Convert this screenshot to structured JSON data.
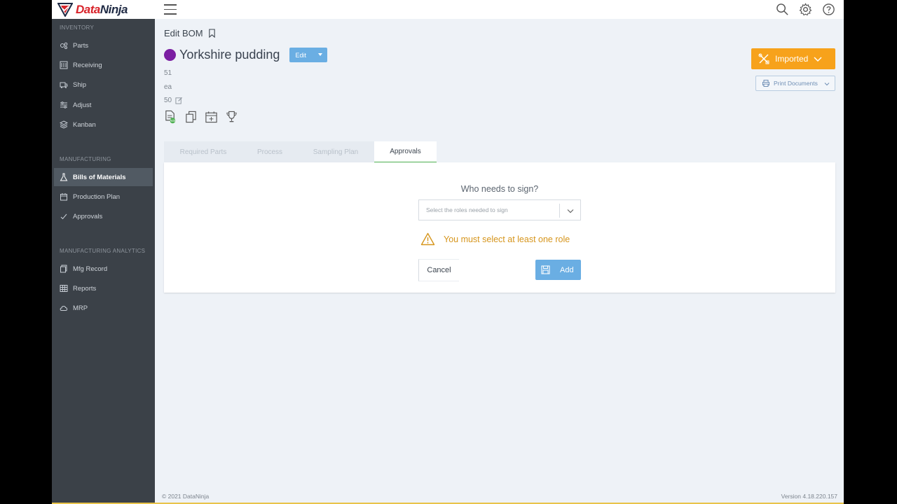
{
  "app": {
    "logo_text_accent": "Data",
    "logo_text_main": "Ninja"
  },
  "sidebar": {
    "sections": [
      {
        "label": "INVENTORY"
      },
      {
        "label": "MANUFACTURING"
      },
      {
        "label": "MANUFACTURING ANALYTICS"
      }
    ],
    "items": [
      {
        "label": "Parts",
        "icon": "parts-icon"
      },
      {
        "label": "Receiving",
        "icon": "receiving-icon"
      },
      {
        "label": "Ship",
        "icon": "ship-icon"
      },
      {
        "label": "Adjust",
        "icon": "adjust-icon"
      },
      {
        "label": "Kanban",
        "icon": "kanban-icon"
      },
      {
        "label": "Bills of Materials",
        "icon": "flask-icon"
      },
      {
        "label": "Production Plan",
        "icon": "calendar-icon"
      },
      {
        "label": "Approvals",
        "icon": "check-icon"
      },
      {
        "label": "Mfg Record",
        "icon": "record-icon"
      },
      {
        "label": "Reports",
        "icon": "reports-icon"
      },
      {
        "label": "MRP",
        "icon": "cloud-icon"
      }
    ],
    "active_item": "Bills of Materials"
  },
  "page": {
    "header": "Edit BOM",
    "bom_name": "Yorkshire pudding",
    "bom_color": "#7b1fa2",
    "edit_label": "Edit",
    "meta_1": "51",
    "meta_2": "ea",
    "meta_3": "50",
    "imported_label": "Imported",
    "print_label": "Print Documents"
  },
  "tabs": [
    {
      "label": "Required Parts"
    },
    {
      "label": "Process"
    },
    {
      "label": "Sampling Plan"
    },
    {
      "label": "Approvals"
    }
  ],
  "panel": {
    "question": "Who needs to sign?",
    "select_placeholder": "Select the roles needed to sign",
    "warning": "You must select at least one role",
    "cancel_label": "Cancel",
    "add_label": "Add"
  },
  "footer": {
    "copyright": "© 2021 DataNinja",
    "version": "Version 4.18.220.157"
  },
  "colors": {
    "sidebar_bg": "#3b4148",
    "accent_blue": "#6aaee3",
    "imported_orange": "#f7a21b",
    "warning": "#d6951c"
  }
}
